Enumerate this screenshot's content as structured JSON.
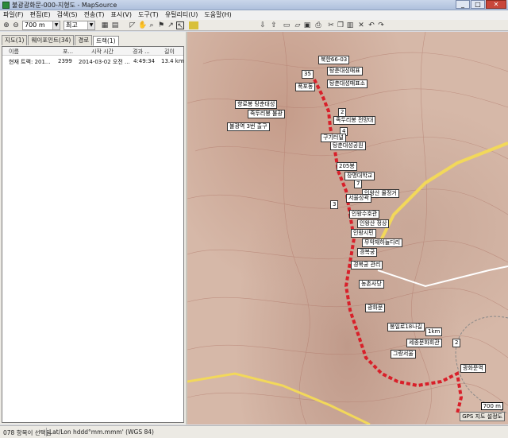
{
  "window": {
    "title": "불광광화문-000-지형도 - MapSource",
    "min": "_",
    "max": "□",
    "close": "✕"
  },
  "menu": [
    "파일(F)",
    "편집(E)",
    "검색(S)",
    "전송(T)",
    "표시(V)",
    "도구(T)",
    "유틸리티(U)",
    "도움말(H)"
  ],
  "toolbar": {
    "zoom_value": "700 m",
    "detail_value": "최고"
  },
  "tabs": [
    {
      "label": "지도(1)"
    },
    {
      "label": "웨이포인트(34)"
    },
    {
      "label": "경로"
    },
    {
      "label": "트랙(1)"
    }
  ],
  "track_list": {
    "headers": [
      "이름",
      "포...",
      "시작 시간",
      "경과 ...",
      "길이"
    ],
    "rows": [
      {
        "name": "현재 트랙: 201...",
        "points": "2399",
        "start": "2014-03-02 오전 ...",
        "elapsed": "4:49:34",
        "length": "13.4 km"
      }
    ]
  },
  "waypoints": [
    "북한66-03",
    "35",
    "탕춘대성매표",
    "탕춘대성매표소",
    "폭포동",
    "향로봉 탕춘대성",
    "2",
    "족두리봉 불광",
    "족두리봉 전망대",
    "불광역 3번 출구",
    "4",
    "구기터널",
    "탕춘대성공원",
    "205봉",
    "장명대학교",
    "7",
    "인왕산 물정거",
    "서울성곽",
    "3",
    "인왕수호관",
    "인왕산 정상",
    "인왕시민",
    "무악재하늘다리",
    "경복궁",
    "경복궁 관리",
    "농촌사당",
    "광화문",
    "봉일로18나길",
    "1km",
    "세종문화회관",
    "2",
    "그랑서울",
    "광화문역"
  ],
  "map": {
    "scale_label": "700 m",
    "legend_label": "GPS 지도 설정도"
  },
  "status": {
    "selection": "078 항목이 선택됨",
    "coords": "Lat/Lon hddd°mm.mmm' (WGS 84)"
  }
}
